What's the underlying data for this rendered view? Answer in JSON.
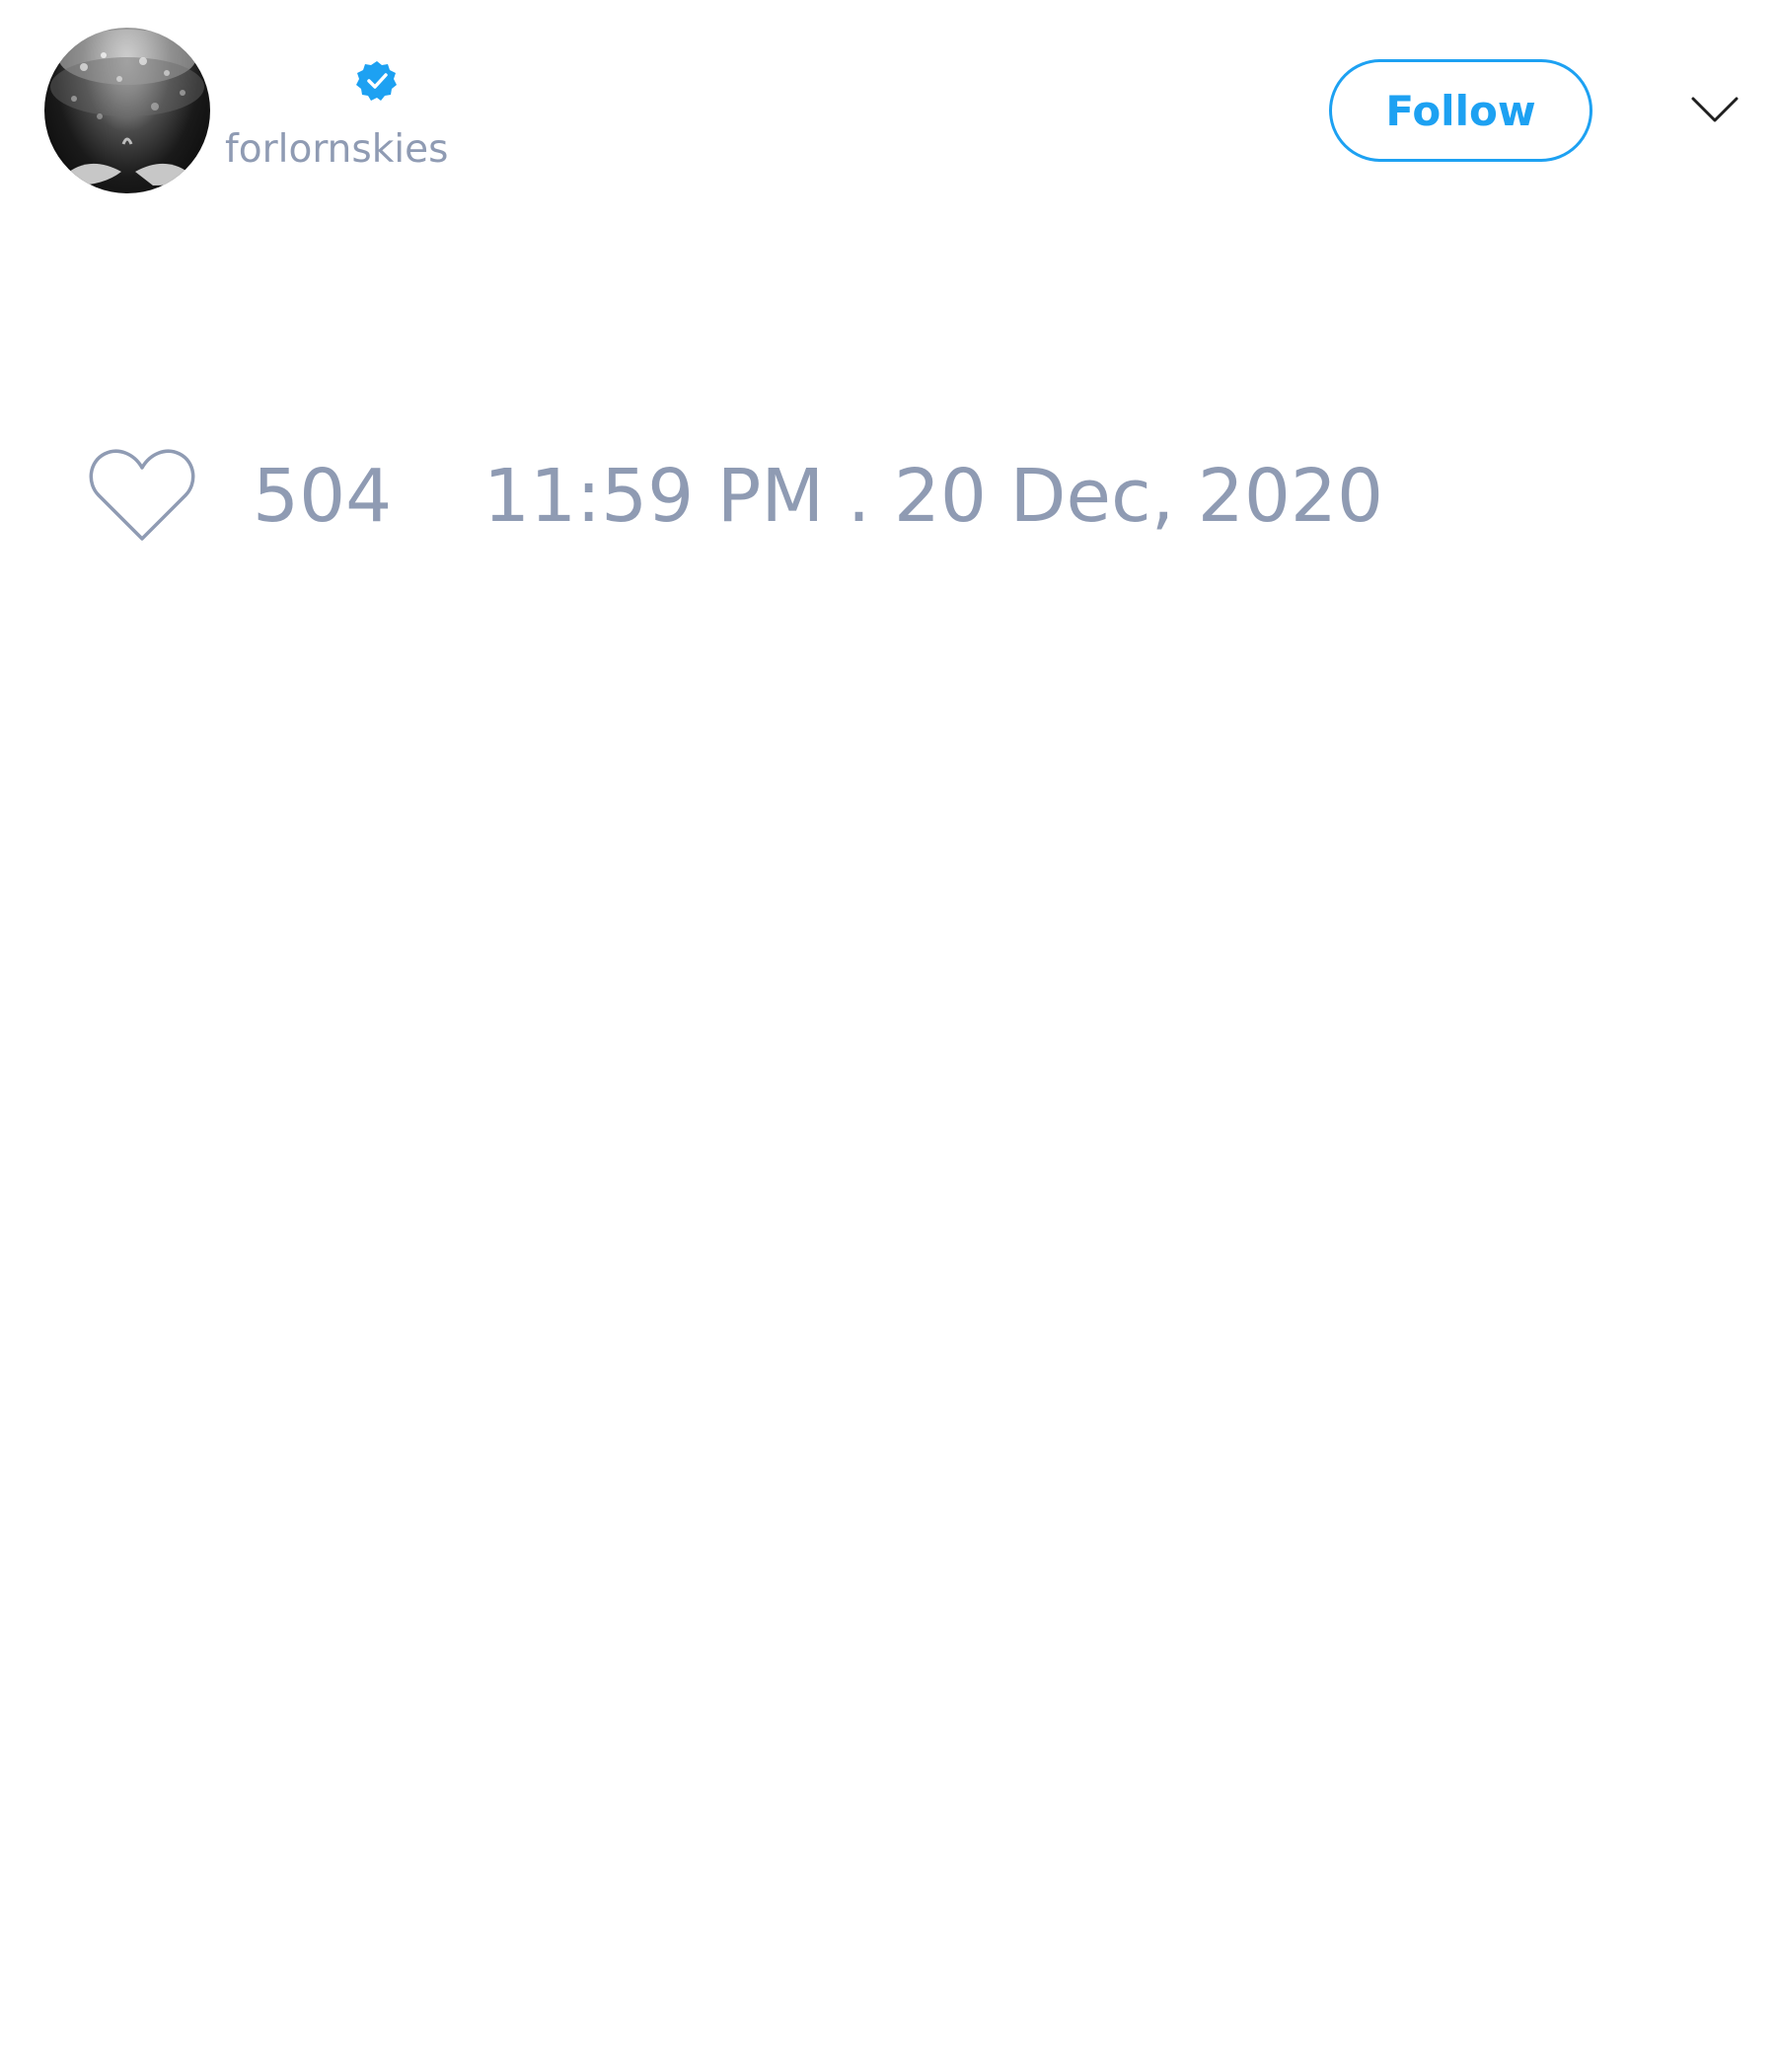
{
  "header": {
    "handle": "forlornskies",
    "avatar_icon": "avatar-photo",
    "verified_icon": "verified-badge-icon",
    "follow_label": "Follow",
    "menu_icon": "chevron-down-icon"
  },
  "stats": {
    "like_icon": "heart-icon",
    "likes": "504",
    "timestamp": "11:59 PM . 20 Dec, 2020"
  },
  "colors": {
    "accent": "#1da1f2",
    "muted_text": "#8f9bb3",
    "background": "#ffffff"
  }
}
